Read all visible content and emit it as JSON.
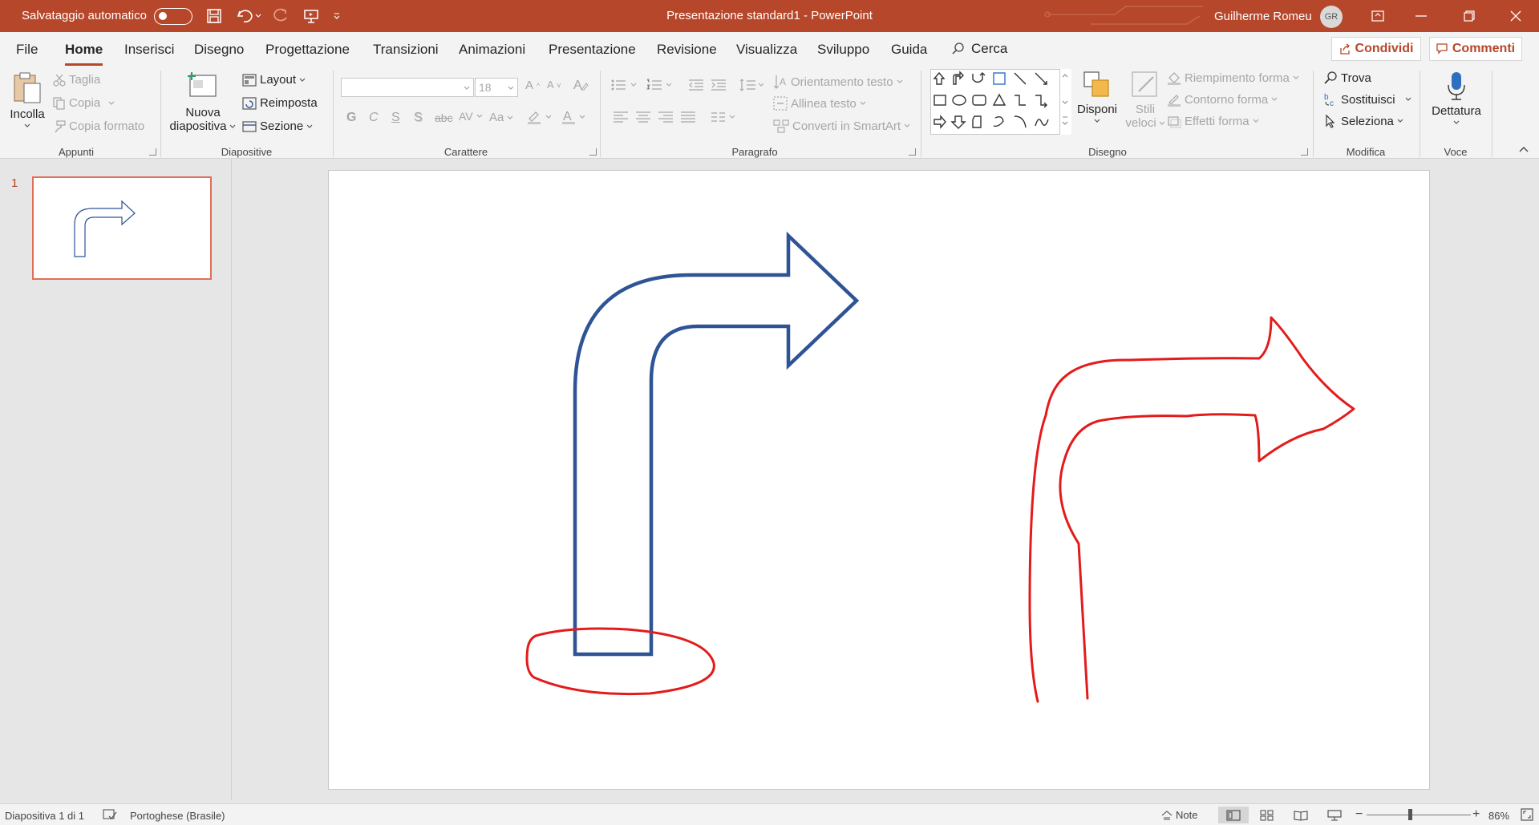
{
  "titlebar": {
    "autosave_label": "Salvataggio automatico",
    "document_title": "Presentazione standard1  -  PowerPoint",
    "user_name": "Guilherme Romeu",
    "user_initials": "GR"
  },
  "tabs": [
    "File",
    "Home",
    "Inserisci",
    "Disegno",
    "Progettazione",
    "Transizioni",
    "Animazioni",
    "Presentazione",
    "Revisione",
    "Visualizza",
    "Sviluppo",
    "Guida"
  ],
  "search_label": "Cerca",
  "share_label": "Condividi",
  "comments_label": "Commenti",
  "ribbon": {
    "clipboard": {
      "paste": "Incolla",
      "cut": "Taglia",
      "copy": "Copia",
      "format_painter": "Copia formato",
      "label": "Appunti"
    },
    "slides": {
      "new_slide_line1": "Nuova",
      "new_slide_line2": "diapositiva",
      "layout": "Layout",
      "reset": "Reimposta",
      "section": "Sezione",
      "label": "Diapositive"
    },
    "font": {
      "font_name": "",
      "font_size": "18",
      "label": "Carattere"
    },
    "paragraph": {
      "text_direction": "Orientamento testo",
      "align_text": "Allinea testo",
      "convert_smartart": "Converti in SmartArt",
      "label": "Paragrafo"
    },
    "drawing": {
      "arrange": "Disponi",
      "quick_styles_line1": "Stili",
      "quick_styles_line2": "veloci",
      "shape_fill": "Riempimento forma",
      "shape_outline": "Contorno forma",
      "shape_effects": "Effetti forma",
      "label": "Disegno"
    },
    "editing": {
      "find": "Trova",
      "replace": "Sostituisci",
      "select": "Seleziona",
      "label": "Modifica"
    },
    "voice": {
      "dictate": "Dettatura",
      "label": "Voce"
    }
  },
  "slides_panel": {
    "slide_number": "1"
  },
  "statusbar": {
    "slide_info": "Diapositiva 1 di 1",
    "language": "Portoghese (Brasile)",
    "notes": "Note",
    "zoom": "86%"
  },
  "colors": {
    "accent": "#b7472a",
    "arrow_stroke": "#2f5496",
    "ink": "#e31b1b"
  }
}
